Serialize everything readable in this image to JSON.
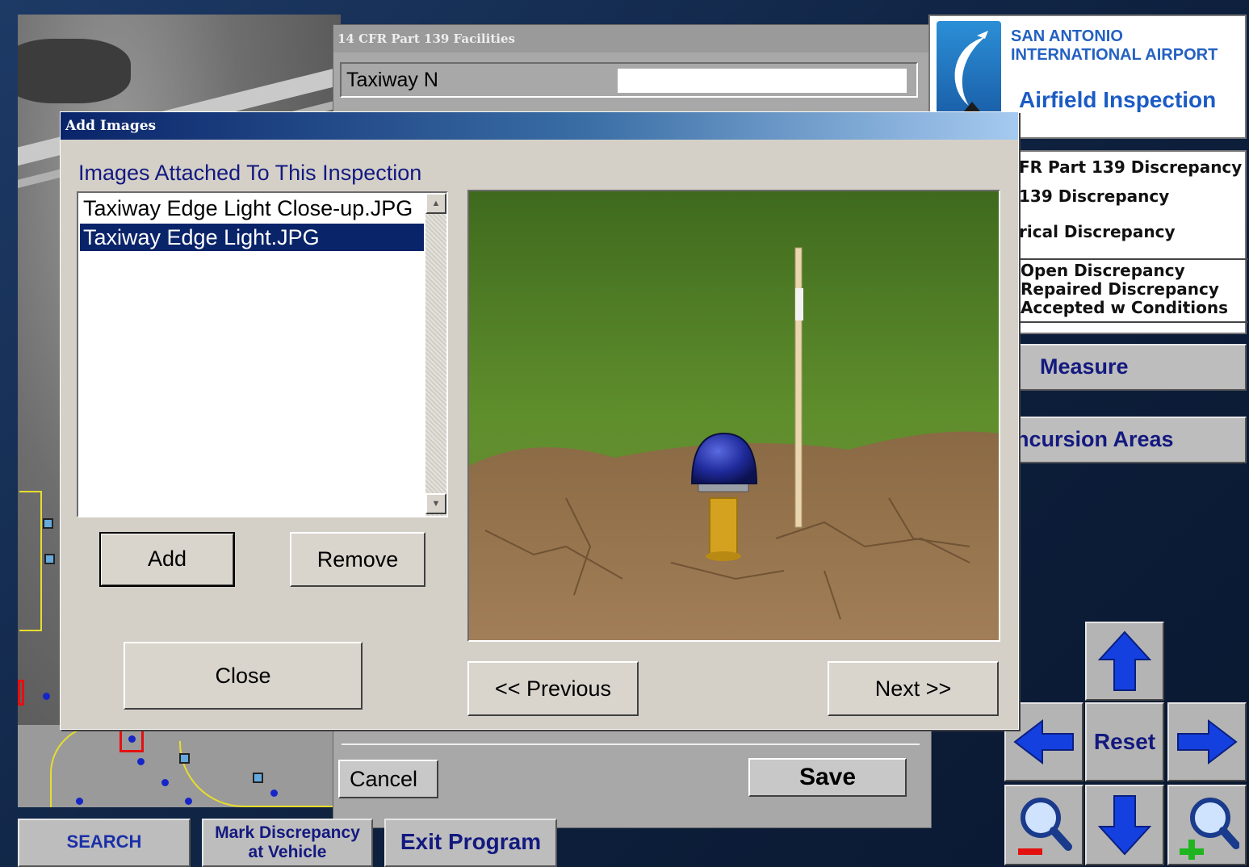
{
  "facilities_window": {
    "title": "14 CFR Part 139 Facilities",
    "location_value": "Taxiway N",
    "cancel_label": "Cancel",
    "save_label": "Save"
  },
  "header": {
    "airport_line1": "SAN ANTONIO",
    "airport_line2": "INTERNATIONAL AIRPORT",
    "app_title": "Airfield Inspection"
  },
  "legend": {
    "types": [
      "FR Part 139 Discrepancy",
      "139 Discrepancy",
      "rical Discrepancy"
    ],
    "statuses": [
      "Open Discrepancy",
      "Repaired Discrepancy",
      "Accepted w Conditions"
    ]
  },
  "side_buttons": {
    "measure": "Measure",
    "incursion": "ncursion Areas"
  },
  "nav": {
    "reset": "Reset"
  },
  "bottom_bar": {
    "search": "SEARCH",
    "mark_line1": "Mark Discrepancy",
    "mark_line2": "at Vehicle",
    "exit": "Exit Program"
  },
  "dialog": {
    "title": "Add Images",
    "section_heading": "Images Attached To This Inspection",
    "images": [
      "Taxiway Edge Light Close-up.JPG",
      "Taxiway Edge Light.JPG"
    ],
    "selected_index": 1,
    "add_label": "Add",
    "remove_label": "Remove",
    "close_label": "Close",
    "previous_label": "<<  Previous",
    "next_label": "Next  >>"
  },
  "colors": {
    "title_bar_start": "#0a246a",
    "selection": "#0a246a",
    "link_blue": "#13197f",
    "arrow_blue": "#1540e0"
  }
}
